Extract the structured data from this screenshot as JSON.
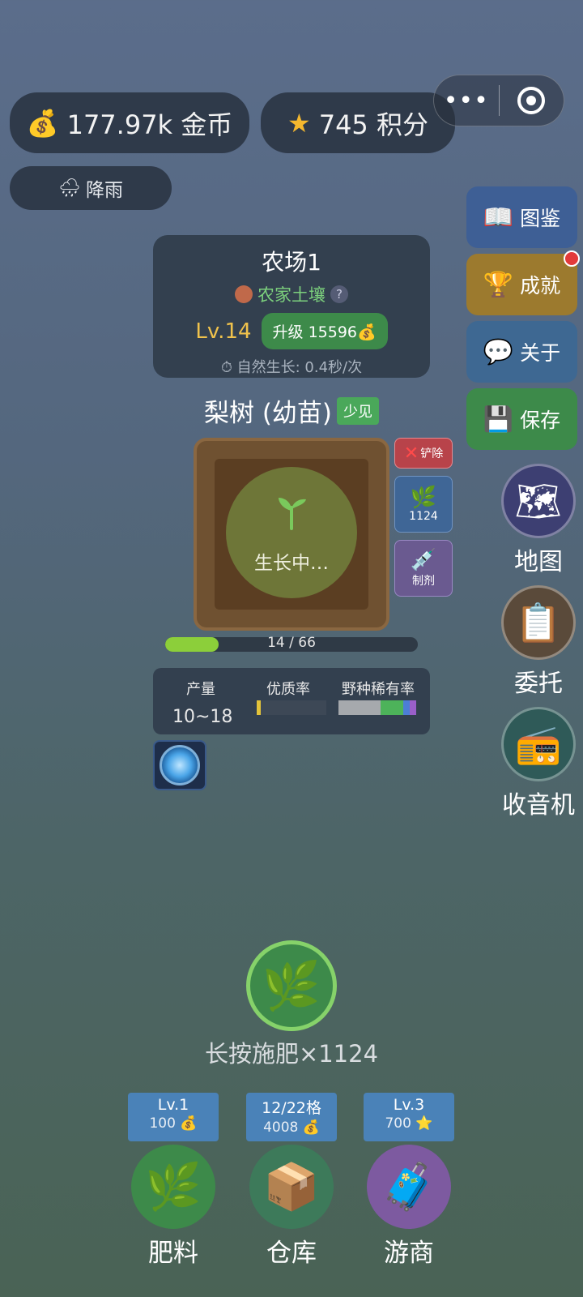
{
  "header": {
    "coins": "177.97k 金币",
    "points": "745 积分",
    "weather": "降雨"
  },
  "side_menu": {
    "book": "图鉴",
    "achievement": "成就",
    "about": "关于",
    "save": "保存"
  },
  "side_round": {
    "map": "地图",
    "commission": "委托",
    "radio": "收音机"
  },
  "farm": {
    "title": "农场1",
    "soil": "农家土壤",
    "help": "?",
    "level": "Lv.14",
    "upgrade": "升级 15596💰",
    "growth": "⏱ 自然生长: 0.4秒/次"
  },
  "plant": {
    "name": "梨树 (幼苗)",
    "rarity": "少见",
    "status": "生长中…",
    "progress_text": "14 / 66",
    "progress": 0.2121
  },
  "plot_actions": {
    "remove": "铲除",
    "fertilizer_count": "1124",
    "agent": "制剂"
  },
  "stats": {
    "yield_label": "产量",
    "yield_value": "10~18",
    "quality_label": "优质率",
    "wild_label": "野种稀有率"
  },
  "fertilize": {
    "label": "长按施肥×1124"
  },
  "shop": {
    "fertilizer_tag1": "Lv.1",
    "fertilizer_tag2": "100 💰",
    "fertilizer_label": "肥料",
    "warehouse_tag1": "12/22格",
    "warehouse_tag2": "4008 💰",
    "warehouse_label": "仓库",
    "merchant_tag1": "Lv.3",
    "merchant_tag2": "700 ⭐",
    "merchant_label": "游商"
  },
  "colors": {
    "accent_green": "#3d8a4a",
    "card_bg": "#33404f",
    "level_gold": "#f0c24c"
  }
}
